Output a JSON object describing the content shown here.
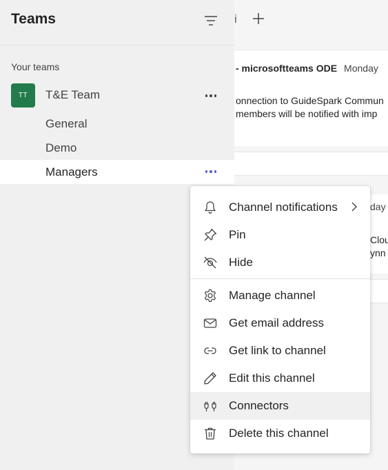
{
  "sidebar": {
    "title": "Teams",
    "section_label": "Your teams",
    "team": {
      "initials": "TT",
      "name": "T&E Team",
      "avatar_color": "#237b4b"
    },
    "channels": [
      {
        "label": "General"
      },
      {
        "label": "Demo"
      },
      {
        "label": "Managers"
      }
    ]
  },
  "main": {
    "tab_truncated": "i",
    "card1": {
      "sender": "- microsoftteams ODE",
      "day": "Monday",
      "line1": "onnection to GuideSpark Commun",
      "line2": "members will be notified with imp"
    },
    "card2": {
      "day": "day",
      "line1": "Clou",
      "line2": "ynn"
    }
  },
  "context_menu": {
    "items": [
      {
        "label": "Channel notifications",
        "icon": "bell-icon",
        "has_submenu": true
      },
      {
        "label": "Pin",
        "icon": "pin-icon"
      },
      {
        "label": "Hide",
        "icon": "eye-off-icon"
      },
      {
        "label": "Manage channel",
        "icon": "gear-icon"
      },
      {
        "label": "Get email address",
        "icon": "mail-icon"
      },
      {
        "label": "Get link to channel",
        "icon": "link-icon"
      },
      {
        "label": "Edit this channel",
        "icon": "pencil-icon"
      },
      {
        "label": "Connectors",
        "icon": "plug-icon",
        "hovered": true
      },
      {
        "label": "Delete this channel",
        "icon": "trash-icon"
      }
    ]
  },
  "colors": {
    "accent": "#5b5fc7",
    "team_avatar": "#237b4b",
    "sidebar_bg": "#f0f0f0",
    "hover_bg": "#f0f0f0"
  }
}
